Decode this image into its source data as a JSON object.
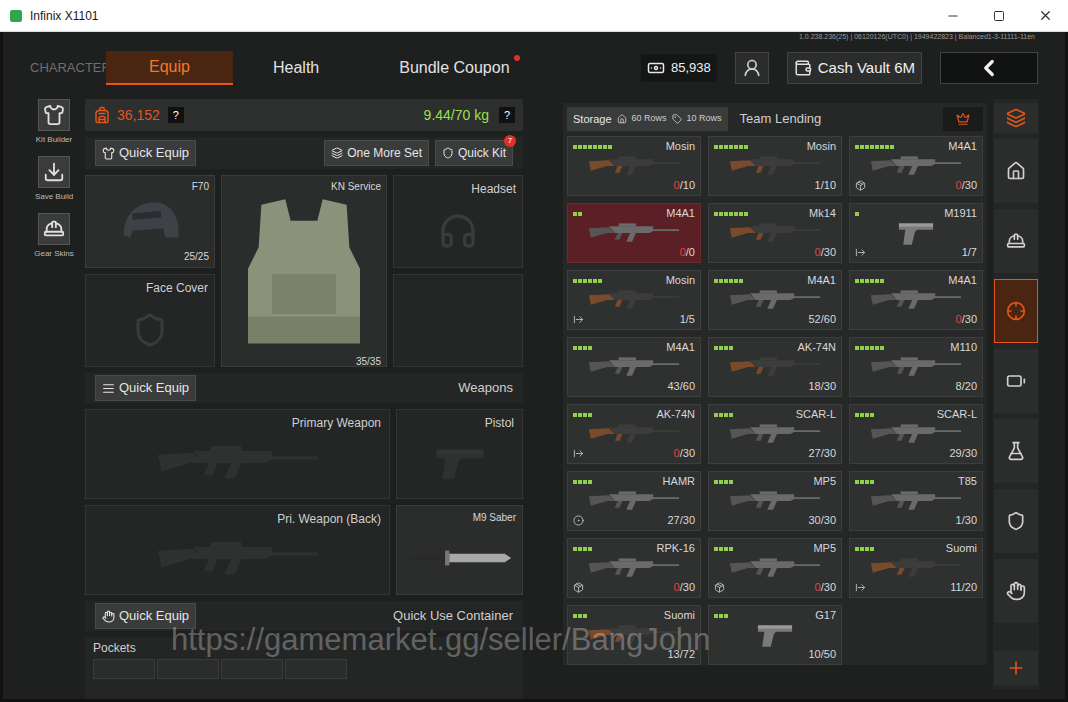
{
  "window": {
    "title": "Infinix X1101"
  },
  "version": "1.0.238.236(25) | 06120126(UTC0) | 1949422823 | Balanced1-3-11111-11en",
  "nav": {
    "section": "CHARACTER",
    "tabs": [
      {
        "label": "Equip",
        "selected": true,
        "dot": false
      },
      {
        "label": "Health",
        "selected": false,
        "dot": false
      },
      {
        "label": "Bundle Coupon",
        "selected": false,
        "dot": true
      }
    ]
  },
  "currency": {
    "amount": "85,938"
  },
  "cash_vault": {
    "label": "Cash Vault 6M"
  },
  "left_tools": [
    {
      "label": "Kit Builder",
      "kind": "kit"
    },
    {
      "label": "Save Build",
      "kind": "save"
    },
    {
      "label": "Gear Skins",
      "kind": "skins"
    }
  ],
  "loadout": {
    "value": "36,152",
    "value_help": "?",
    "weight": "9.44/70 kg",
    "weight_help": "?",
    "quick_equip": "Quick Equip",
    "one_more_set": "One More Set",
    "quick_kit": "Quick Kit",
    "quick_kit_badge": "7"
  },
  "gear": {
    "helmet": {
      "name": "F70",
      "durability": "25/25"
    },
    "armor": {
      "name": "KN Service",
      "durability": "35/35"
    },
    "headset": {
      "label": "Headset"
    },
    "face_cover": {
      "label": "Face Cover"
    }
  },
  "weapons": {
    "quick_equip": "Quick Equip",
    "title": "Weapons",
    "primary": "Primary Weapon",
    "pistol": "Pistol",
    "back": "Pri. Weapon (Back)",
    "melee": "M9 Saber"
  },
  "container": {
    "quick_equip": "Quick Equip",
    "title": "Quick Use Container",
    "pockets": "Pockets",
    "pocket_slots": 4
  },
  "storage": {
    "label": "Storage",
    "rows": "60 Rows",
    "extra_rows": "10 Rows",
    "team_lending": "Team Lending"
  },
  "items": [
    {
      "name": "Mosin",
      "bars": 8,
      "loaded": "0",
      "capacity": "/10",
      "empty": true,
      "damaged": false,
      "mark": "none",
      "kind": "wood"
    },
    {
      "name": "Mosin",
      "bars": 7,
      "loaded": "1",
      "capacity": "/10",
      "empty": false,
      "damaged": false,
      "mark": "none",
      "kind": "wood"
    },
    {
      "name": "M4A1",
      "bars": 8,
      "loaded": "0",
      "capacity": "/30",
      "empty": true,
      "damaged": false,
      "mark": "box",
      "kind": "rifle"
    },
    {
      "name": "M4A1",
      "bars": 2,
      "loaded": "0",
      "capacity": "/0",
      "empty": true,
      "damaged": true,
      "mark": "none",
      "kind": "rifle"
    },
    {
      "name": "Mk14",
      "bars": 7,
      "loaded": "0",
      "capacity": "/30",
      "empty": true,
      "damaged": false,
      "mark": "none",
      "kind": "wood"
    },
    {
      "name": "M1911",
      "bars": 1,
      "loaded": "1",
      "capacity": "/7",
      "empty": false,
      "damaged": false,
      "mark": "exit",
      "kind": "pistol"
    },
    {
      "name": "Mosin",
      "bars": 6,
      "loaded": "1",
      "capacity": "/5",
      "empty": false,
      "damaged": false,
      "mark": "exit",
      "kind": "wood"
    },
    {
      "name": "M4A1",
      "bars": 6,
      "loaded": "52",
      "capacity": "/60",
      "empty": false,
      "damaged": false,
      "mark": "none",
      "kind": "rifle"
    },
    {
      "name": "M4A1",
      "bars": 6,
      "loaded": "0",
      "capacity": "/30",
      "empty": true,
      "damaged": false,
      "mark": "none",
      "kind": "rifle"
    },
    {
      "name": "M4A1",
      "bars": 4,
      "loaded": "43",
      "capacity": "/60",
      "empty": false,
      "damaged": false,
      "mark": "none",
      "kind": "rifle"
    },
    {
      "name": "AK-74N",
      "bars": 4,
      "loaded": "18",
      "capacity": "/30",
      "empty": false,
      "damaged": false,
      "mark": "none",
      "kind": "wood"
    },
    {
      "name": "M110",
      "bars": 6,
      "loaded": "8",
      "capacity": "/20",
      "empty": false,
      "damaged": false,
      "mark": "none",
      "kind": "rifle"
    },
    {
      "name": "AK-74N",
      "bars": 4,
      "loaded": "0",
      "capacity": "/30",
      "empty": true,
      "damaged": false,
      "mark": "exit",
      "kind": "wood"
    },
    {
      "name": "SCAR-L",
      "bars": 4,
      "loaded": "27",
      "capacity": "/30",
      "empty": false,
      "damaged": false,
      "mark": "none",
      "kind": "rifle"
    },
    {
      "name": "SCAR-L",
      "bars": 4,
      "loaded": "29",
      "capacity": "/30",
      "empty": false,
      "damaged": false,
      "mark": "none",
      "kind": "rifle"
    },
    {
      "name": "HAMR",
      "bars": 4,
      "loaded": "27",
      "capacity": "/30",
      "empty": false,
      "damaged": false,
      "mark": "circle",
      "kind": "rifle"
    },
    {
      "name": "MP5",
      "bars": 4,
      "loaded": "30",
      "capacity": "/30",
      "empty": false,
      "damaged": false,
      "mark": "none",
      "kind": "rifle"
    },
    {
      "name": "T85",
      "bars": 4,
      "loaded": "1",
      "capacity": "/30",
      "empty": false,
      "damaged": false,
      "mark": "none",
      "kind": "rifle"
    },
    {
      "name": "RPK-16",
      "bars": 4,
      "loaded": "0",
      "capacity": "/30",
      "empty": true,
      "damaged": false,
      "mark": "box",
      "kind": "rifle"
    },
    {
      "name": "MP5",
      "bars": 4,
      "loaded": "0",
      "capacity": "/30",
      "empty": true,
      "damaged": false,
      "mark": "box",
      "kind": "rifle"
    },
    {
      "name": "Suomi",
      "bars": 4,
      "loaded": "11",
      "capacity": "/20",
      "empty": false,
      "damaged": false,
      "mark": "exit",
      "kind": "wood"
    },
    {
      "name": "Suomi",
      "bars": 3,
      "loaded": "13",
      "capacity": "/72",
      "empty": false,
      "damaged": false,
      "mark": "none",
      "kind": "wood"
    },
    {
      "name": "G17",
      "bars": 3,
      "loaded": "10",
      "capacity": "/50",
      "empty": false,
      "damaged": false,
      "mark": "none",
      "kind": "pistol"
    }
  ],
  "side_nav": [
    {
      "kind": "layers",
      "selected": false,
      "accent": true
    },
    {
      "kind": "home",
      "selected": false,
      "accent": false
    },
    {
      "kind": "helmet",
      "selected": false,
      "accent": false
    },
    {
      "kind": "weapon",
      "selected": true,
      "accent": true
    },
    {
      "kind": "magazine",
      "selected": false,
      "accent": false
    },
    {
      "kind": "bottle",
      "selected": false,
      "accent": false
    },
    {
      "kind": "armor",
      "selected": false,
      "accent": false
    },
    {
      "kind": "hand",
      "selected": false,
      "accent": false
    },
    {
      "kind": "add",
      "selected": false,
      "accent": true
    }
  ],
  "watermark": "https://gamemarket.gg/seller/BangJohn"
}
